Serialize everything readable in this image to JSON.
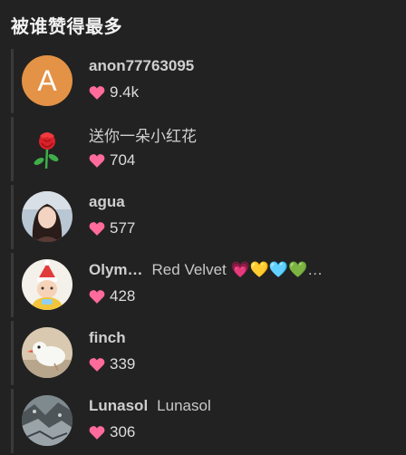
{
  "header": {
    "title": "被谁赞得最多"
  },
  "users": [
    {
      "name": "anon77763095",
      "comment": "",
      "likes": "9.4k",
      "avatar_letter": "A",
      "name_bold": true
    },
    {
      "name": "送你一朵小红花",
      "comment": "",
      "likes": "704",
      "avatar_icon": "rose-icon",
      "name_bold": false
    },
    {
      "name": "agua",
      "comment": "",
      "likes": "577",
      "avatar_icon": "girl-photo",
      "name_bold": true
    },
    {
      "name": "Olym…",
      "comment": "Red Velvet 💗💛🩵💚…",
      "likes": "428",
      "avatar_icon": "child-photo",
      "name_bold": true
    },
    {
      "name": "finch",
      "comment": "",
      "likes": "339",
      "avatar_icon": "bird-photo",
      "name_bold": true
    },
    {
      "name": "Lunasol",
      "comment": "Lunasol",
      "likes": "306",
      "avatar_icon": "rock-photo",
      "name_bold": true
    }
  ],
  "colors": {
    "heart": "#ff6b9a",
    "accent_avatar": "#e49246",
    "background": "#222222"
  }
}
